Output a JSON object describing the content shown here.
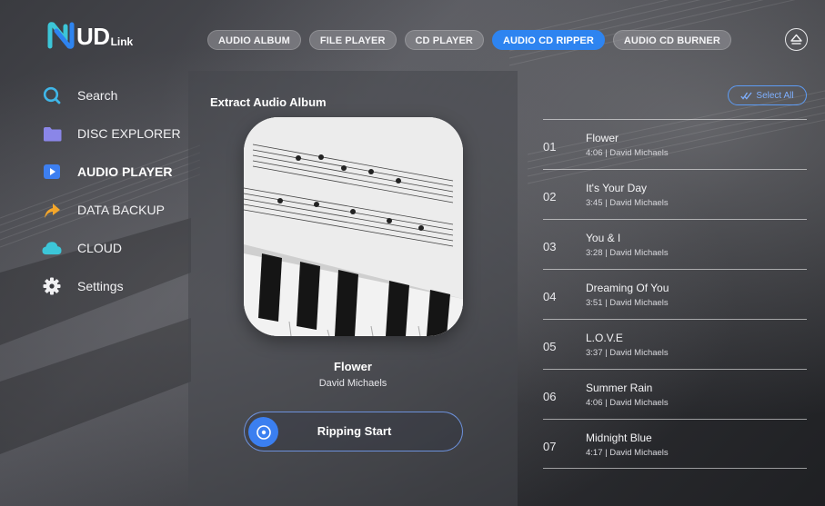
{
  "app": {
    "logo_text": "UD",
    "logo_sub": "Link"
  },
  "tabs": [
    {
      "label": "AUDIO ALBUM",
      "active": false
    },
    {
      "label": "FILE PLAYER",
      "active": false
    },
    {
      "label": "CD PLAYER",
      "active": false
    },
    {
      "label": "AUDIO CD RIPPER",
      "active": true
    },
    {
      "label": "AUDIO CD BURNER",
      "active": false
    }
  ],
  "sidebar": {
    "items": [
      {
        "label": "Search",
        "icon": "search-icon",
        "active": false
      },
      {
        "label": "DISC EXPLORER",
        "icon": "folder-icon",
        "active": false
      },
      {
        "label": "AUDIO PLAYER",
        "icon": "play-icon",
        "active": true
      },
      {
        "label": "DATA BACKUP",
        "icon": "backup-arrow-icon",
        "active": false
      },
      {
        "label": "CLOUD",
        "icon": "cloud-icon",
        "active": false
      },
      {
        "label": "Settings",
        "icon": "gear-icon",
        "active": false
      }
    ]
  },
  "center": {
    "title": "Extract Audio Album",
    "now_title": "Flower",
    "now_artist": "David Michaels",
    "rip_label": "Ripping Start"
  },
  "list": {
    "select_all": "Select All",
    "tracks": [
      {
        "num": "01",
        "title": "Flower",
        "meta": "4:06 | David Michaels"
      },
      {
        "num": "02",
        "title": "It's Your Day",
        "meta": "3:45 | David Michaels"
      },
      {
        "num": "03",
        "title": "You & I",
        "meta": "3:28 | David Michaels"
      },
      {
        "num": "04",
        "title": "Dreaming Of You",
        "meta": "3:51 | David Michaels"
      },
      {
        "num": "05",
        "title": "L.O.V.E",
        "meta": "3:37 | David Michaels"
      },
      {
        "num": "06",
        "title": "Summer Rain",
        "meta": "4:06 | David Michaels"
      },
      {
        "num": "07",
        "title": "Midnight Blue",
        "meta": "4:17 | David Michaels"
      }
    ]
  },
  "colors": {
    "accent": "#2e84f0",
    "search_icon": "#3fb6e8",
    "folder_icon": "#8a86e8",
    "play_icon": "#3d7ff0",
    "backup_icon": "#f4a62a",
    "cloud_icon": "#3cc6d8",
    "gear_icon": "#f0f0f2"
  }
}
